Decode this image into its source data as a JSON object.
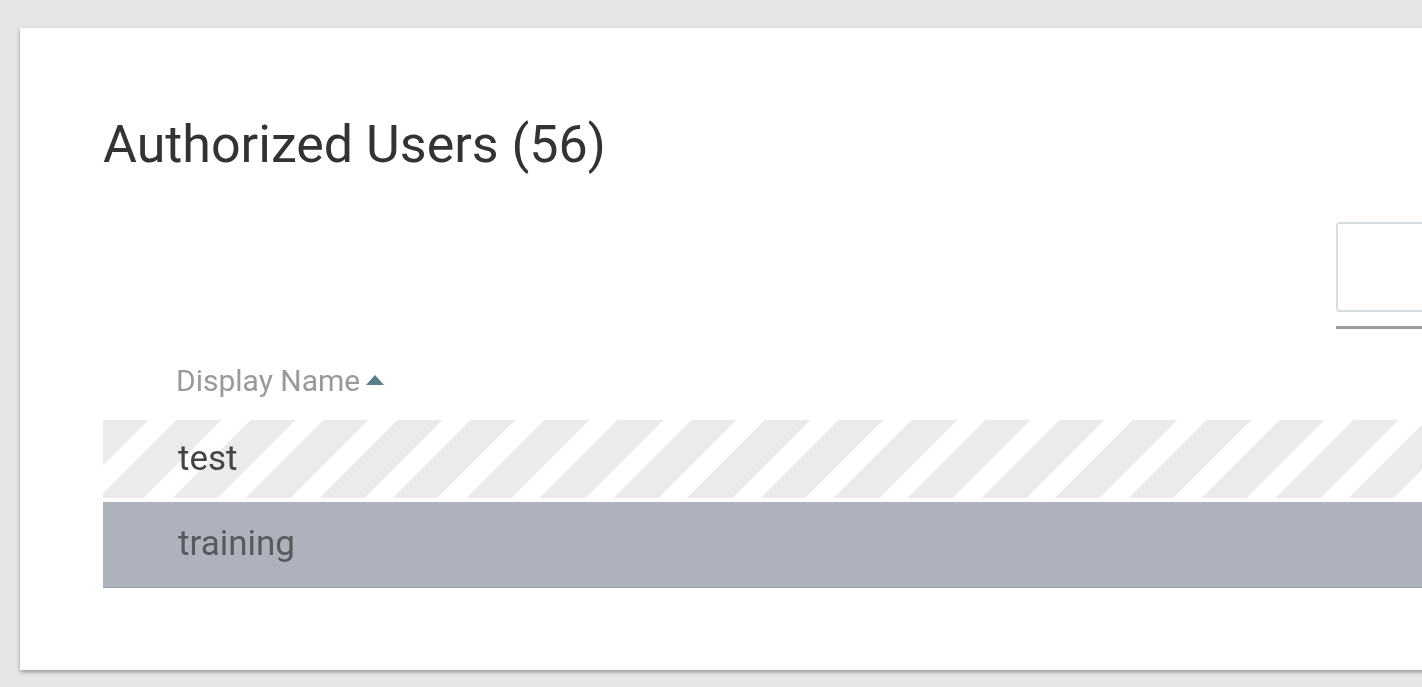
{
  "title": "Authorized Users (56)",
  "table": {
    "columns": [
      {
        "label": "Display Name",
        "sorted_ascending": true
      }
    ],
    "rows": [
      {
        "cells": [
          "test"
        ],
        "striped": true,
        "selected": false
      },
      {
        "cells": [
          "training"
        ],
        "striped": false,
        "selected": true
      }
    ]
  }
}
